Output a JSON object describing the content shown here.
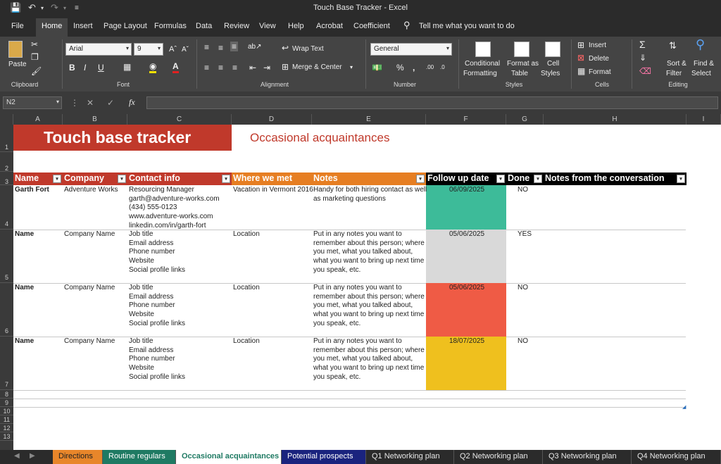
{
  "window": {
    "title": "Touch Base Tracker  -  Excel"
  },
  "menu": [
    "File",
    "Home",
    "Insert",
    "Page Layout",
    "Formulas",
    "Data",
    "Review",
    "View",
    "Help",
    "Acrobat",
    "Coefficient"
  ],
  "tell_me": "Tell me what you want to do",
  "ribbon": {
    "paste": "Paste",
    "clipboard": "Clipboard",
    "font_name": "Arial",
    "font_size": "9",
    "font": "Font",
    "wrap_text": "Wrap Text",
    "merge_center": "Merge & Center",
    "alignment": "Alignment",
    "number_format": "General",
    "number": "Number",
    "conditional": "Conditional",
    "formatting": "Formatting",
    "format_as": "Format as",
    "table": "Table",
    "cell": "Cell",
    "styles_btn": "Styles",
    "styles": "Styles",
    "insert": "Insert",
    "delete": "Delete",
    "format": "Format",
    "cells": "Cells",
    "sort": "Sort &",
    "filter": "Filter",
    "find": "Find &",
    "select": "Select",
    "editing": "Editing"
  },
  "formula_bar": {
    "name_box": "N2",
    "fx": "fx"
  },
  "columns": [
    "A",
    "B",
    "C",
    "D",
    "E",
    "F",
    "G",
    "H",
    "I"
  ],
  "rows": [
    "1",
    "2",
    "3",
    "4",
    "5",
    "6",
    "7",
    "8",
    "9",
    "10",
    "11",
    "12",
    "13"
  ],
  "sheet": {
    "title": "Touch base tracker",
    "subtitle": "Occasional acquaintances",
    "headers": [
      "Name",
      "Company",
      "Contact info",
      "Where we met",
      "Notes",
      "Follow up date",
      "Done",
      "Notes from the conversation"
    ],
    "records": [
      {
        "name": "Garth Fort",
        "company": "Adventure Works",
        "contact": [
          "Resourcing Manager",
          "garth@adventure-works.com",
          "(434) 555-0123",
          "www.adventure-works.com",
          "linkedin.com/in/garth-fort"
        ],
        "where": "Vacation in Vermont 2016",
        "notes": [
          "Handy for both hiring contact as well",
          "as marketing questions"
        ],
        "date": "06/09/2025",
        "done": "NO",
        "color": "#3dbb99"
      },
      {
        "name": "Name",
        "company": "Company Name",
        "contact": [
          "Job title",
          "Email address",
          "Phone number",
          "Website",
          "Social profile links"
        ],
        "where": "Location",
        "notes": [
          "Put in any notes you want to",
          "remember about this person; where",
          "you met, what you talked about,",
          "what you want to bring up next time",
          "you speak, etc."
        ],
        "date": "05/06/2025",
        "done": "YES",
        "color": "#d9d9d9"
      },
      {
        "name": "Name",
        "company": "Company Name",
        "contact": [
          "Job title",
          "Email address",
          "Phone number",
          "Website",
          "Social profile links"
        ],
        "where": "Location",
        "notes": [
          "Put in any notes you want to",
          "remember about this person; where",
          "you met, what you talked about,",
          "what you want to bring up next time",
          "you speak, etc."
        ],
        "date": "05/06/2025",
        "done": "NO",
        "color": "#ef5b45"
      },
      {
        "name": "Name",
        "company": "Company Name",
        "contact": [
          "Job title",
          "Email address",
          "Phone number",
          "Website",
          "Social profile links"
        ],
        "where": "Location",
        "notes": [
          "Put in any notes you want to",
          "remember about this person; where",
          "you met, what you talked about,",
          "what you want to bring up next time",
          "you speak, etc."
        ],
        "date": "18/07/2025",
        "done": "NO",
        "color": "#efc01e"
      }
    ]
  },
  "tabs": [
    {
      "label": "Directions",
      "color": "#e8862a"
    },
    {
      "label": "Routine regulars",
      "color": "#1f7a63"
    },
    {
      "label": "Occasional acquaintances",
      "color": "#ffffff"
    },
    {
      "label": "Potential prospects",
      "color": "#1a237e"
    },
    {
      "label": "Q1 Networking plan",
      "color": ""
    },
    {
      "label": "Q2 Networking plan",
      "color": ""
    },
    {
      "label": "Q3 Networking plan",
      "color": ""
    },
    {
      "label": "Q4 Networking plan",
      "color": ""
    }
  ],
  "colors": {
    "title_bg": "#c0392b",
    "subtitle": "#c0392b",
    "header_red": "#c0392b",
    "header_orange": "#e67e22",
    "header_black": "#000000"
  }
}
